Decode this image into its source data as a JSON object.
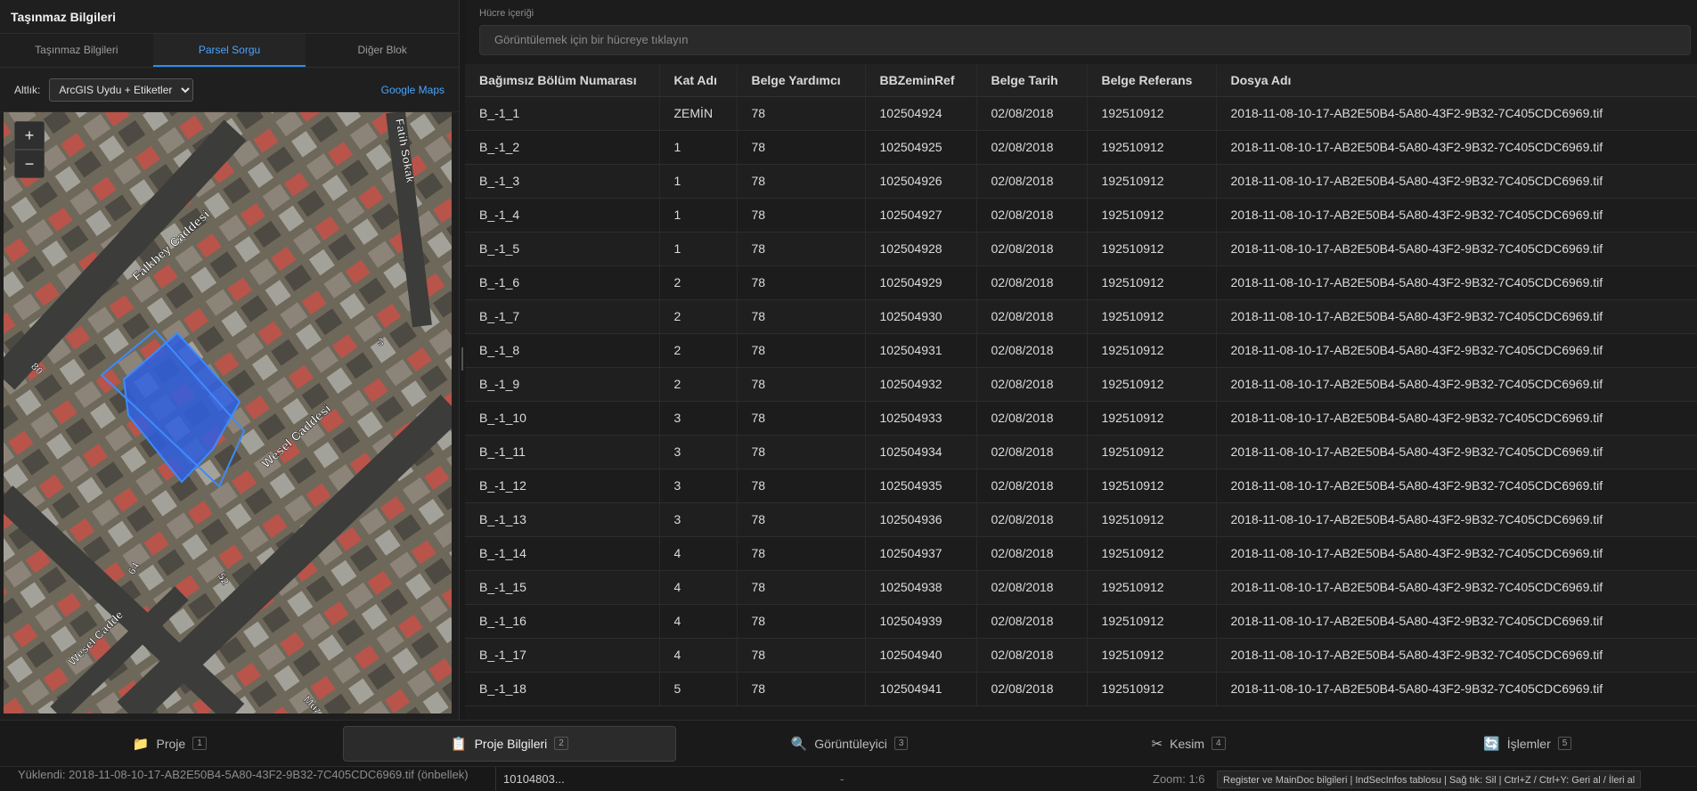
{
  "left_panel": {
    "title": "Taşınmaz Bilgileri",
    "tabs": [
      {
        "label": "Taşınmaz Bilgileri"
      },
      {
        "label": "Parsel Sorgu"
      },
      {
        "label": "Diğer Blok"
      }
    ],
    "active_tab": "Parsel Sorgu",
    "basemap_label": "Altlık:",
    "basemap_selected": "ArcGIS Uydu + Etiketler",
    "google_maps_label": "Google Maps",
    "zoom_in_label": "+",
    "zoom_out_label": "−",
    "map_labels": {
      "street_1": "Falkbey Caddesi",
      "street_2": "Fatih Sokak",
      "street_3": "Wesel Caddesi",
      "street_4": "Wesel Cadde",
      "number_1": "80",
      "number_2": "3",
      "number_3": "64",
      "number_4": "52",
      "corner_text": "Muz"
    },
    "highlight_color": "#2f5fe0"
  },
  "cell_viewer": {
    "label": "Hücre içeriği",
    "placeholder": "Görüntülemek için bir hücreye tıklayın"
  },
  "table": {
    "columns": [
      "Bağımsız Bölüm Numarası",
      "Kat Adı",
      "Belge Yardımcı",
      "BBZeminRef",
      "Belge Tarih",
      "Belge Referans",
      "Dosya Adı"
    ],
    "rows": [
      [
        "B_-1_1",
        "ZEMİN",
        "78",
        "102504924",
        "02/08/2018",
        "192510912",
        "2018-11-08-10-17-AB2E50B4-5A80-43F2-9B32-7C405CDC6969.tif"
      ],
      [
        "B_-1_2",
        "1",
        "78",
        "102504925",
        "02/08/2018",
        "192510912",
        "2018-11-08-10-17-AB2E50B4-5A80-43F2-9B32-7C405CDC6969.tif"
      ],
      [
        "B_-1_3",
        "1",
        "78",
        "102504926",
        "02/08/2018",
        "192510912",
        "2018-11-08-10-17-AB2E50B4-5A80-43F2-9B32-7C405CDC6969.tif"
      ],
      [
        "B_-1_4",
        "1",
        "78",
        "102504927",
        "02/08/2018",
        "192510912",
        "2018-11-08-10-17-AB2E50B4-5A80-43F2-9B32-7C405CDC6969.tif"
      ],
      [
        "B_-1_5",
        "1",
        "78",
        "102504928",
        "02/08/2018",
        "192510912",
        "2018-11-08-10-17-AB2E50B4-5A80-43F2-9B32-7C405CDC6969.tif"
      ],
      [
        "B_-1_6",
        "2",
        "78",
        "102504929",
        "02/08/2018",
        "192510912",
        "2018-11-08-10-17-AB2E50B4-5A80-43F2-9B32-7C405CDC6969.tif"
      ],
      [
        "B_-1_7",
        "2",
        "78",
        "102504930",
        "02/08/2018",
        "192510912",
        "2018-11-08-10-17-AB2E50B4-5A80-43F2-9B32-7C405CDC6969.tif"
      ],
      [
        "B_-1_8",
        "2",
        "78",
        "102504931",
        "02/08/2018",
        "192510912",
        "2018-11-08-10-17-AB2E50B4-5A80-43F2-9B32-7C405CDC6969.tif"
      ],
      [
        "B_-1_9",
        "2",
        "78",
        "102504932",
        "02/08/2018",
        "192510912",
        "2018-11-08-10-17-AB2E50B4-5A80-43F2-9B32-7C405CDC6969.tif"
      ],
      [
        "B_-1_10",
        "3",
        "78",
        "102504933",
        "02/08/2018",
        "192510912",
        "2018-11-08-10-17-AB2E50B4-5A80-43F2-9B32-7C405CDC6969.tif"
      ],
      [
        "B_-1_11",
        "3",
        "78",
        "102504934",
        "02/08/2018",
        "192510912",
        "2018-11-08-10-17-AB2E50B4-5A80-43F2-9B32-7C405CDC6969.tif"
      ],
      [
        "B_-1_12",
        "3",
        "78",
        "102504935",
        "02/08/2018",
        "192510912",
        "2018-11-08-10-17-AB2E50B4-5A80-43F2-9B32-7C405CDC6969.tif"
      ],
      [
        "B_-1_13",
        "3",
        "78",
        "102504936",
        "02/08/2018",
        "192510912",
        "2018-11-08-10-17-AB2E50B4-5A80-43F2-9B32-7C405CDC6969.tif"
      ],
      [
        "B_-1_14",
        "4",
        "78",
        "102504937",
        "02/08/2018",
        "192510912",
        "2018-11-08-10-17-AB2E50B4-5A80-43F2-9B32-7C405CDC6969.tif"
      ],
      [
        "B_-1_15",
        "4",
        "78",
        "102504938",
        "02/08/2018",
        "192510912",
        "2018-11-08-10-17-AB2E50B4-5A80-43F2-9B32-7C405CDC6969.tif"
      ],
      [
        "B_-1_16",
        "4",
        "78",
        "102504939",
        "02/08/2018",
        "192510912",
        "2018-11-08-10-17-AB2E50B4-5A80-43F2-9B32-7C405CDC6969.tif"
      ],
      [
        "B_-1_17",
        "4",
        "78",
        "102504940",
        "02/08/2018",
        "192510912",
        "2018-11-08-10-17-AB2E50B4-5A80-43F2-9B32-7C405CDC6969.tif"
      ],
      [
        "B_-1_18",
        "5",
        "78",
        "102504941",
        "02/08/2018",
        "192510912",
        "2018-11-08-10-17-AB2E50B4-5A80-43F2-9B32-7C405CDC6969.tif"
      ]
    ]
  },
  "bottom_nav": [
    {
      "label": "Proje",
      "badge": "1",
      "icon": "folder-icon",
      "glyph": "📁",
      "active": false
    },
    {
      "label": "Proje Bilgileri",
      "badge": "2",
      "icon": "clipboard-icon",
      "glyph": "📋",
      "active": true
    },
    {
      "label": "Görüntüleyici",
      "badge": "3",
      "icon": "magnifier-icon",
      "glyph": "🔍",
      "active": false
    },
    {
      "label": "Kesim",
      "badge": "4",
      "icon": "scissors-icon",
      "glyph": "✂",
      "active": false
    },
    {
      "label": "İşlemler",
      "badge": "5",
      "icon": "refresh-icon",
      "glyph": "🔄",
      "active": false
    }
  ],
  "status_bar": {
    "loaded_file": "Yüklendi: 2018-11-08-10-17-AB2E50B4-5A80-43F2-9B32-7C405CDC6969.tif (önbellek)",
    "selected_id": "10104803...",
    "dash": "-",
    "zoom": "Zoom: 1:6",
    "hint": "Register ve MainDoc bilgileri | IndSecInfos tablosu | Sağ tık: Sil | Ctrl+Z / Ctrl+Y: Geri al / İleri al"
  }
}
